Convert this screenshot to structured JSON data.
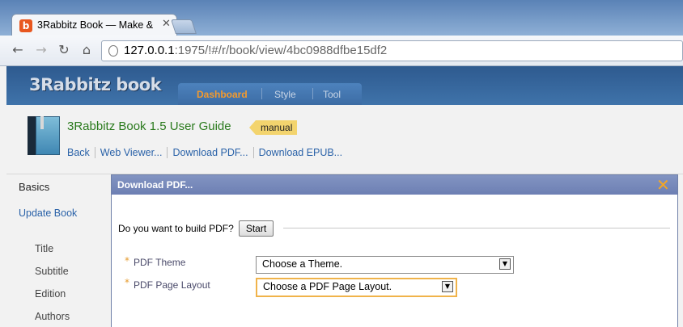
{
  "browser": {
    "tab_title": "3Rabbitz Book — Make &",
    "favicon_letter": "b",
    "url_host": "127.0.0.1",
    "url_rest": ":1975/!#/r/book/view/4bc0988dfbe15df2"
  },
  "app": {
    "logo": "3Rabbitz book",
    "menu": [
      "Dashboard",
      "Style",
      "Tool"
    ]
  },
  "book": {
    "title": "3Rabbitz Book 1.5 User Guide",
    "tag": "manual",
    "links": [
      "Back",
      "Web Viewer...",
      "Download PDF...",
      "Download EPUB..."
    ]
  },
  "sidebar": {
    "title": "Basics",
    "update_link": "Update Book",
    "fields": [
      "Title",
      "Subtitle",
      "Edition",
      "Authors"
    ]
  },
  "dialog": {
    "title": "Download PDF...",
    "question": "Do you want to build PDF?",
    "start_label": "Start",
    "required_mark": "*",
    "theme_label": "PDF Theme",
    "theme_value": "Choose a Theme.",
    "layout_label": "PDF Page Layout",
    "layout_value": "Choose a PDF Page Layout."
  },
  "colors": {
    "accent_orange": "#f39a2e",
    "header_blue": "#3f73aa",
    "dialog_header": "#7384b8"
  }
}
